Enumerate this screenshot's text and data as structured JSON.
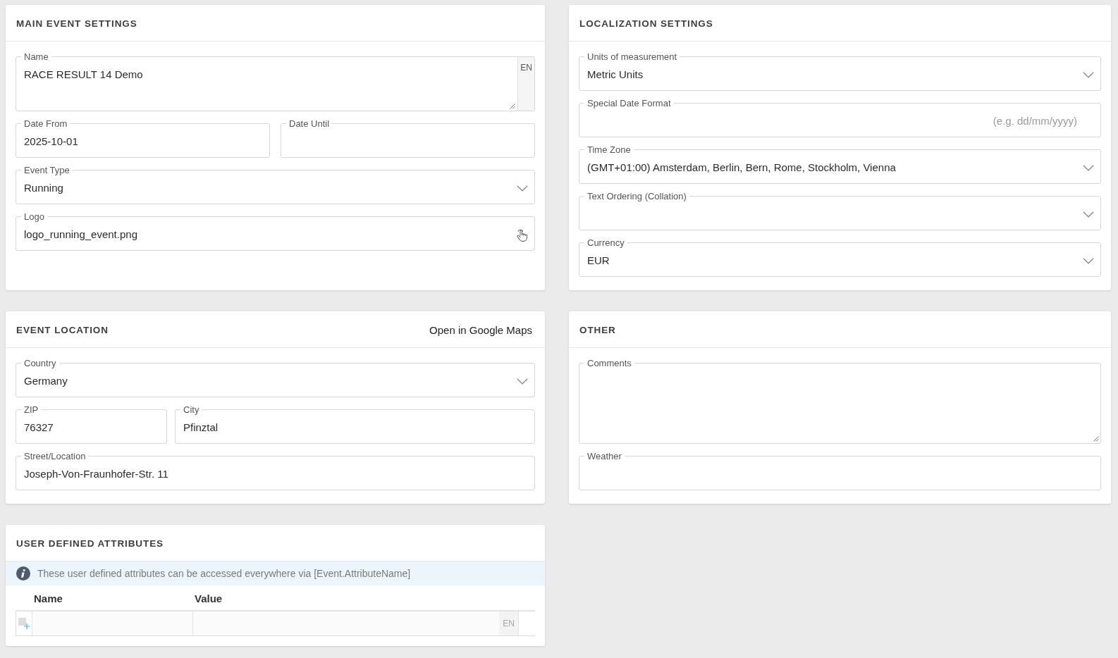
{
  "panels": [
    {
      "title": "MAIN EVENT SETTINGS",
      "fields": [
        {
          "kind": "textarea",
          "label": "Name",
          "value": "RACE RESULT 14 Demo",
          "language": "EN"
        },
        {
          "kind": "pair",
          "fields": [
            {
              "kind": "text",
              "label": "Date From",
              "value": "2025-10-01"
            },
            {
              "kind": "text",
              "label": "Date Until"
            }
          ]
        },
        {
          "kind": "select",
          "label": "Event Type",
          "value": "Running"
        },
        {
          "kind": "file",
          "label": "Logo",
          "value": "logo_running_event.png"
        }
      ]
    },
    {
      "title": "LOCALIZATION SETTINGS",
      "fields": [
        {
          "kind": "select",
          "label": "Units of measurement",
          "value": "Metric Units"
        },
        {
          "kind": "text",
          "label": "Special Date Format",
          "placeholder": "(e.g. dd/mm/yyyy)"
        },
        {
          "kind": "select",
          "label": "Time Zone",
          "value": "(GMT+01:00) Amsterdam, Berlin, Bern, Rome, Stockholm, Vienna"
        },
        {
          "kind": "select",
          "label": "Text Ordering (Collation)"
        },
        {
          "kind": "select",
          "label": "Currency",
          "value": "EUR"
        }
      ]
    },
    {
      "title": "EVENT LOCATION",
      "link": "Open in Google Maps",
      "fields": [
        {
          "kind": "select",
          "label": "Country",
          "value": "Germany"
        },
        {
          "kind": "short_long",
          "fields": [
            {
              "kind": "text",
              "label": "ZIP",
              "value": "76327"
            },
            {
              "kind": "text",
              "label": "City",
              "value": "Pfinztal"
            }
          ]
        },
        {
          "kind": "text",
          "label": "Street/Location",
          "value": "Joseph-Von-Fraunhofer-Str. 11"
        }
      ]
    },
    {
      "title": "OTHER",
      "fields": [
        {
          "kind": "memo",
          "label": "Comments"
        },
        {
          "kind": "text",
          "label": "Weather"
        }
      ]
    },
    {
      "title": "USER DEFINED ATTRIBUTES",
      "info": "These user defined attributes can be accessed everywhere via [Event.AttributeName]",
      "table": {
        "columns": [
          "Name",
          "Value"
        ],
        "rows": [
          {
            "language": "EN"
          }
        ]
      }
    }
  ]
}
